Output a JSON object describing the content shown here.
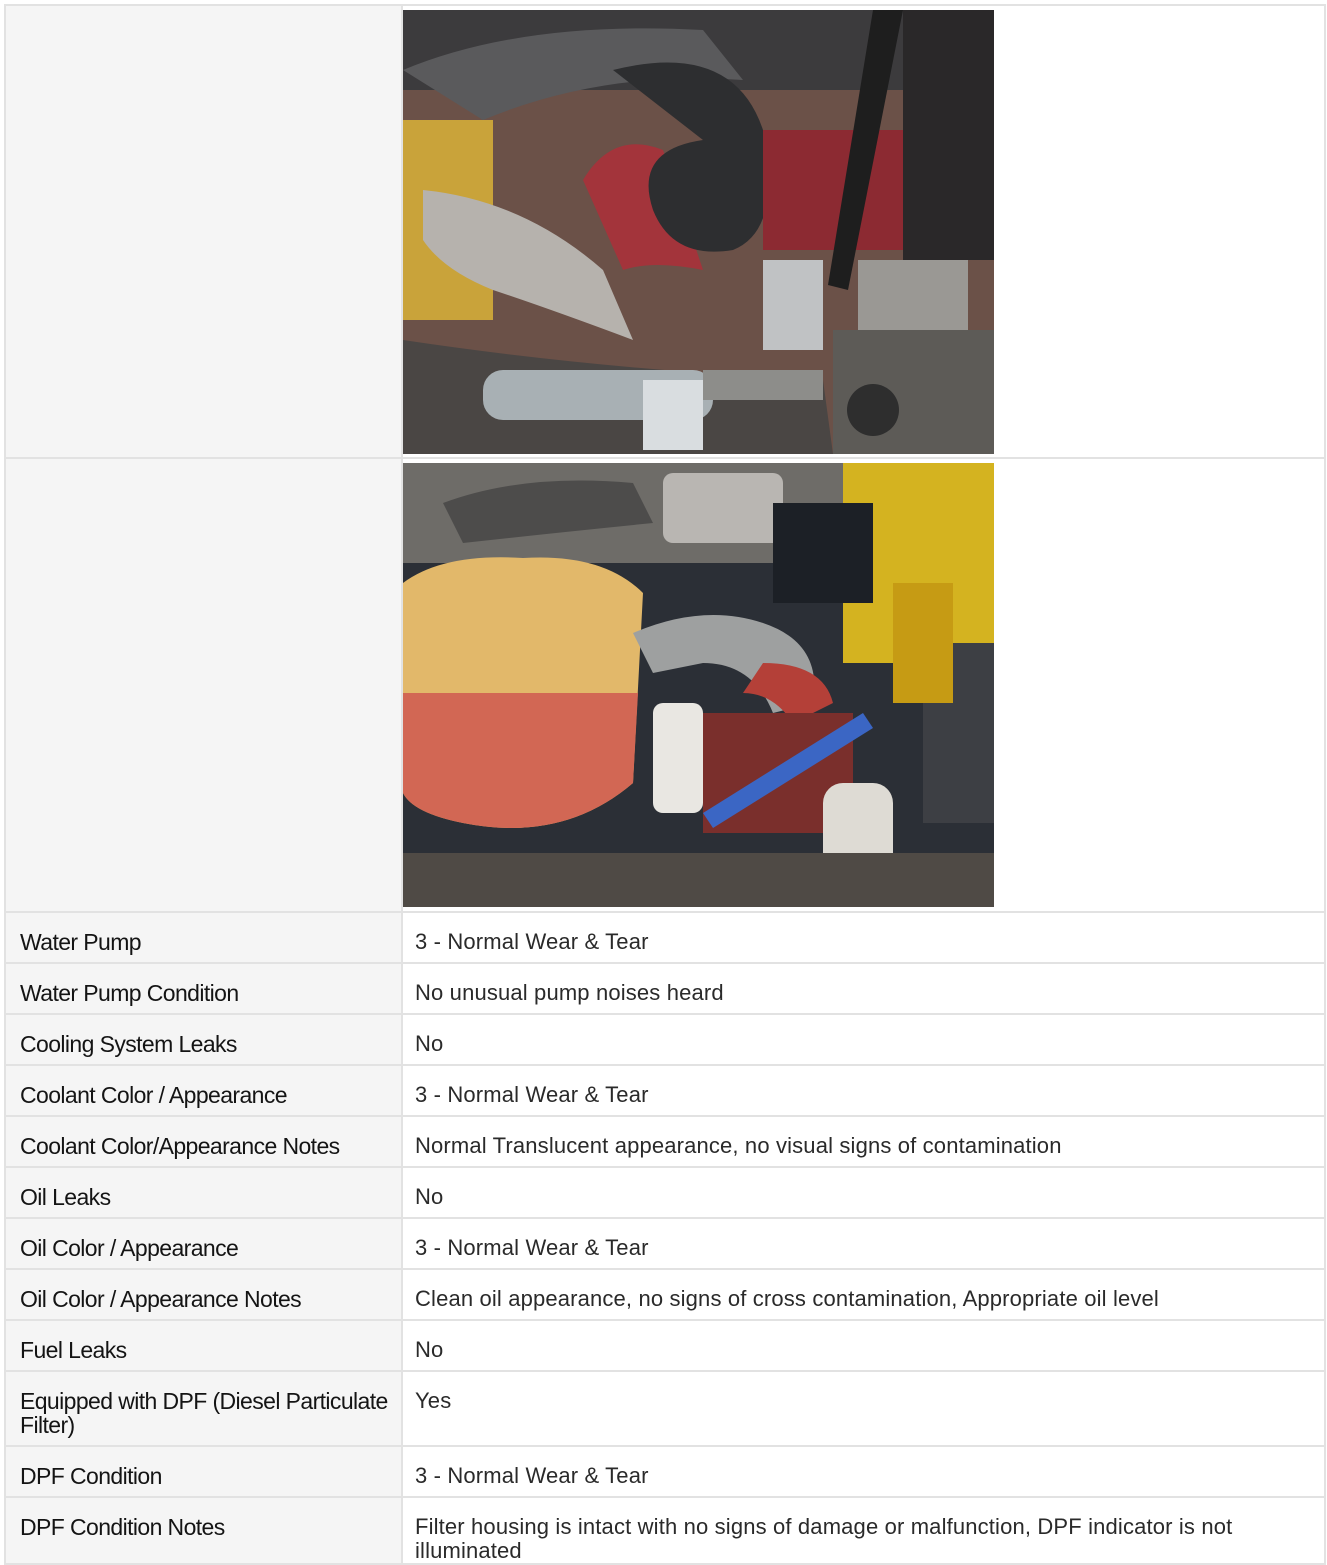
{
  "photos": [
    {
      "icon": "engine-photo-hoses-icon"
    },
    {
      "icon": "engine-photo-coolant-reservoir-icon"
    }
  ],
  "rows": [
    {
      "label": "Water Pump",
      "value": "3 - Normal Wear & Tear"
    },
    {
      "label": "Water Pump Condition",
      "value": "No unusual pump noises heard"
    },
    {
      "label": "Cooling System Leaks",
      "value": "No"
    },
    {
      "label": "Coolant Color / Appearance",
      "value": "3 - Normal Wear & Tear"
    },
    {
      "label": "Coolant Color/Appearance Notes",
      "value": "Normal Translucent appearance, no visual signs of contamination"
    },
    {
      "label": "Oil Leaks",
      "value": "No"
    },
    {
      "label": "Oil Color / Appearance",
      "value": "3 - Normal Wear & Tear"
    },
    {
      "label": "Oil Color / Appearance Notes",
      "value": "Clean oil appearance, no signs of cross contamination, Appropriate oil level"
    },
    {
      "label": "Fuel Leaks",
      "value": "No"
    },
    {
      "label": "Equipped with DPF (Diesel Particulate Filter)",
      "value": "Yes"
    },
    {
      "label": "DPF Condition",
      "value": "3 - Normal Wear & Tear"
    },
    {
      "label": "DPF Condition Notes",
      "value": "Filter housing is intact with no signs of damage or malfunction, DPF indicator is not illuminated"
    }
  ]
}
